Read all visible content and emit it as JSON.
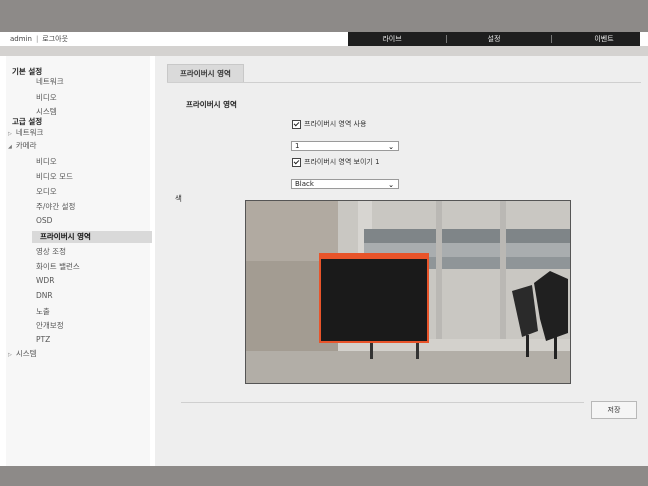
{
  "header": {
    "user": "admin",
    "logout": "로그아웃",
    "nav": [
      {
        "label": "라이브"
      },
      {
        "label": "설정"
      },
      {
        "label": "이벤트"
      }
    ]
  },
  "sidebar": {
    "basic_heading": "기본 설정",
    "basic_items": [
      "네트워크",
      "비디오",
      "시스템"
    ],
    "advanced_heading": "고급 설정",
    "network": "네트워크",
    "camera": "카메라",
    "camera_items": [
      "비디오",
      "비디오 모드",
      "오디오",
      "주/야간 설정",
      "OSD",
      "프라이버시 영역",
      "영상 조정",
      "화이트 밸런스",
      "WDR",
      "DNR",
      "노출",
      "안개보정",
      "PTZ"
    ],
    "system": "시스템"
  },
  "main": {
    "tab": "프라이버시 영역",
    "section_title": "프라이버시 영역",
    "enable_label": "프라이버시 영역 사용",
    "enable_checked": true,
    "zone_select": "1",
    "show_label": "프라이버시 영역 보이기 1",
    "show_checked": true,
    "color_label": "색",
    "color_select": "Black",
    "save_label": "저장",
    "mask_border_color": "#e8542a",
    "mask_fill_color": "#1a1a1a"
  }
}
